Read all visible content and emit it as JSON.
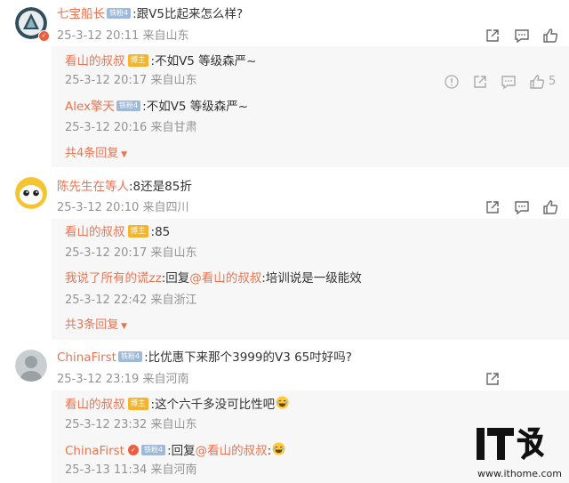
{
  "comments": [
    {
      "user": "七宝船长",
      "badge": "铁粉4",
      "text": ":跟V5比起来怎么样?",
      "meta": "25-3-12 20:11 来自山东",
      "replies": [
        {
          "user": "看山的叔叔",
          "badge": "博主",
          "text": ":不如V5  等级森严~",
          "meta": "25-3-12 20:17 来自山东",
          "likes": "5"
        },
        {
          "user": "Alex擎天",
          "badge": "铁粉4",
          "text": ":不如V5  等级森严~",
          "meta": "25-3-12 20:16 来自甘肃"
        }
      ],
      "expand": "共4条回复"
    },
    {
      "user": "陈先生在等人",
      "text": ":8还是85折",
      "meta": "25-3-12 20:10 来自四川",
      "replies": [
        {
          "user": "看山的叔叔",
          "badge": "博主",
          "text": ":85",
          "meta": "25-3-12 20:17 来自山东"
        },
        {
          "user": "我说了所有的谎zz",
          "text_prefix": ":回复",
          "mention": "@看山的叔叔",
          "text": ":培训说是一级能效",
          "meta": "25-3-12 22:42 来自浙江"
        }
      ],
      "expand": "共3条回复"
    },
    {
      "user": "ChinaFirst",
      "badge": "铁粉4",
      "text": ":比优惠下来那个3999的V3 65吋好吗?",
      "meta": "25-3-12 23:19 来自河南",
      "replies": [
        {
          "user": "看山的叔叔",
          "badge": "博主",
          "text": ":这个六千多没可比性吧",
          "meta": "25-3-12 23:32 来自山东"
        },
        {
          "user": "ChinaFirst",
          "badge": "铁粉4",
          "text_prefix": ":回复",
          "mention": "@看山的叔叔",
          "text": ":",
          "meta": "25-3-13 11:34 来自河南"
        }
      ]
    }
  ],
  "watermark": {
    "logo_text": "IT之家",
    "url": "www.ithome.com"
  },
  "colors": {
    "name": "#eb7350",
    "meta": "#939393",
    "reply_bg": "#f7f7f7",
    "fan_badge": "#9fb9d9",
    "up_badge": "#f6b42d"
  },
  "icons": [
    "share-icon",
    "comment-icon",
    "like-icon",
    "report-icon",
    "laugh-emoji-icon"
  ]
}
